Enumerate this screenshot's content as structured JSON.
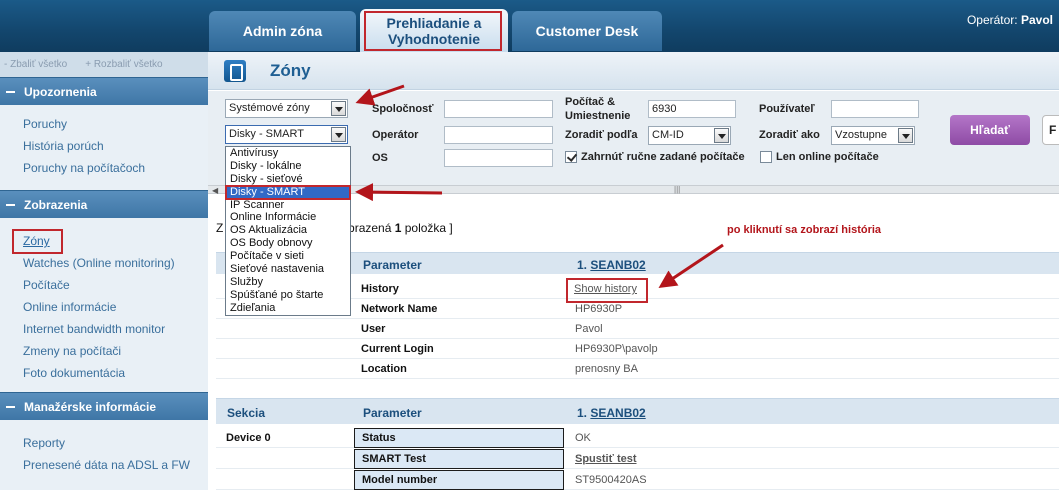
{
  "header": {
    "tabs": [
      {
        "label": "Admin zóna"
      },
      {
        "label": "Prehliadanie a Vyhodnotenie"
      },
      {
        "label": "Customer Desk"
      }
    ],
    "operator_label": "Operátor:",
    "operator_name": "Pavol"
  },
  "sidebar": {
    "collapse_all": "- Zbaliť všetko",
    "expand_all": "+ Rozbaliť všetko",
    "sections": [
      {
        "title": "Upozornenia",
        "items": [
          "Poruchy",
          "História porúch",
          "Poruchy na počítačoch"
        ]
      },
      {
        "title": "Zobrazenia",
        "items": [
          "Zóny",
          "Watches (Online monitoring)",
          "Počítače",
          "Online informácie",
          "Internet bandwidth monitor",
          "Zmeny na počítači",
          "Foto dokumentácia"
        ]
      },
      {
        "title": "Manažérske informácie",
        "items": [
          "Reporty",
          "Prenesené dáta na ADSL a FW"
        ]
      }
    ]
  },
  "main": {
    "title": "Zóny",
    "filters": {
      "zone_type": "Systémové zóny",
      "zone": "Disky - SMART",
      "company_label": "Spoločnosť",
      "operator_label": "Operátor",
      "os_label": "OS",
      "computer_label_1": "Počítač &",
      "computer_label_2": "Umiestnenie",
      "computer_value": "6930",
      "sort_by_label": "Zoradiť podľa",
      "sort_by_value": "CM-ID",
      "user_label": "Používateľ",
      "sort_order_label": "Zoradiť ako",
      "sort_order_value": "Vzostupne",
      "include_manual_label": "Zahrnúť ručne zadané počítače",
      "online_only_label": "Len online počítače",
      "search_button": "Hľadať",
      "extra_button": "F"
    },
    "dropdown_options": [
      "Antivírusy",
      "Disky - lokálne",
      "Disky - sieťové",
      "Disky - SMART",
      "IP Scanner",
      "Online Informácie",
      "OS Aktualizácia",
      "OS Body obnovy",
      "Počítače v sieti",
      "Sieťové nastavenia",
      "Služby",
      "Spúšťané po štarte",
      "Zdieľania"
    ],
    "result_prefix": "Z",
    "result_text_before": "obrazená ",
    "result_count": "1",
    "result_text_after": " položka ]",
    "table1": {
      "col_param": "Parameter",
      "col_value_prefix": "1.",
      "col_value_link": "SEANB02",
      "rows": [
        {
          "k": "History",
          "v": "Show history"
        },
        {
          "k": "Network Name",
          "v": "HP6930P"
        },
        {
          "k": "User",
          "v": "Pavol"
        },
        {
          "k": "Current Login",
          "v": "HP6930P\\pavolp"
        },
        {
          "k": "Location",
          "v": "prenosny BA"
        }
      ]
    },
    "table2": {
      "col_section": "Sekcia",
      "col_param": "Parameter",
      "col_value_prefix": "1.",
      "col_value_link": "SEANB02",
      "section_name": "Device 0",
      "rows": [
        {
          "k": "Status",
          "v": "OK"
        },
        {
          "k": "SMART Test",
          "v": "Spustiť test"
        },
        {
          "k": "Model number",
          "v": "ST9500420AS"
        }
      ]
    },
    "annotation": "po kliknutí sa zobrazí história"
  },
  "colors": {
    "accent": "#1f5f93",
    "highlight": "#c1272d",
    "search_button": "#9b59b6"
  }
}
